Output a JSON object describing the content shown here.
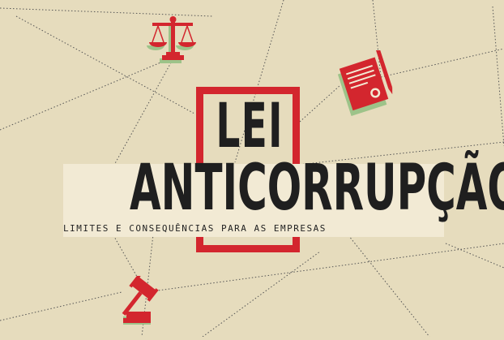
{
  "title": {
    "top": "LEI",
    "main": "ANTICORRUPÇÃO",
    "subtitle": "LIMITES E CONSEQUÊNCIAS PARA AS EMPRESAS"
  },
  "colors": {
    "background": "#e6dcbd",
    "accent_red": "#d3262e",
    "shadow_green": "#9dc389",
    "text": "#1f1f1f"
  },
  "icons": [
    "scales-icon",
    "document-pen-icon",
    "gavel-icon"
  ]
}
